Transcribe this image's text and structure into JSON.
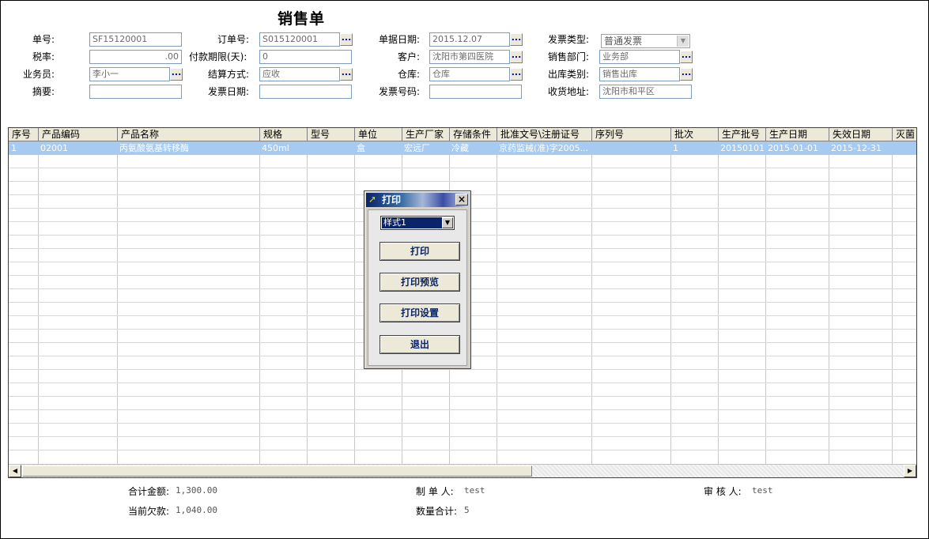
{
  "form": {
    "title": "销售单",
    "fields": {
      "order_no_label": "单号:",
      "order_no": "SF15120001",
      "po_no_label": "订单号:",
      "po_no": "S015120001",
      "doc_date_label": "单据日期:",
      "doc_date": "2015.12.07",
      "invoice_type_label": "发票类型:",
      "invoice_type": "普通发票",
      "tax_rate_label": "税率:",
      "tax_rate": ".00",
      "pay_term_label": "付款期限(天):",
      "pay_term": "0",
      "customer_label": "客户:",
      "customer": "沈阳市第四医院",
      "sales_dept_label": "销售部门:",
      "sales_dept": "业务部",
      "salesman_label": "业务员:",
      "salesman": "李小一",
      "settle_label": "结算方式:",
      "settle": "应收",
      "warehouse_label": "仓库:",
      "warehouse": "仓库",
      "out_type_label": "出库类别:",
      "out_type": "销售出库",
      "summary_label": "摘要:",
      "summary": "",
      "invoice_date_label": "发票日期:",
      "invoice_date": "",
      "invoice_no_label": "发票号码:",
      "invoice_no": "",
      "ship_addr_label": "收货地址:",
      "ship_addr": "沈阳市和平区"
    },
    "ellipsis": "..."
  },
  "grid": {
    "columns": [
      "序号",
      "产品编码",
      "产品名称",
      "规格",
      "型号",
      "单位",
      "生产厂家",
      "存储条件",
      "批准文号\\注册证号",
      "序列号",
      "批次",
      "生产批号",
      "生产日期",
      "失效日期",
      "灭菌"
    ],
    "rows": [
      [
        "1",
        "02001",
        "丙氨酸氨基转移酶",
        "450ml",
        "",
        "盒",
        "宏远厂",
        "冷藏",
        "京药监械(准)字2005...",
        "",
        "1",
        "20150101",
        "2015-01-01",
        "2015-12-31",
        ""
      ]
    ]
  },
  "footer": {
    "total_amount_label": "合计金额:",
    "total_amount": "1,300.00",
    "maker_label": "制 单 人:",
    "maker": "test",
    "reviewer_label": "审 核 人:",
    "reviewer": "test",
    "owed_label": "当前欠款:",
    "owed": "1,040.00",
    "qty_label": "数量合计:",
    "qty": "5"
  },
  "dialog": {
    "title": "打印",
    "style_value": "样式1",
    "print": "打印",
    "preview": "打印预览",
    "setup": "打印设置",
    "exit": "退出",
    "close": "×"
  },
  "colors": {
    "selected_row": "#a6caf0",
    "title_bar": "#0a246a",
    "button_text": "#0a246a"
  }
}
